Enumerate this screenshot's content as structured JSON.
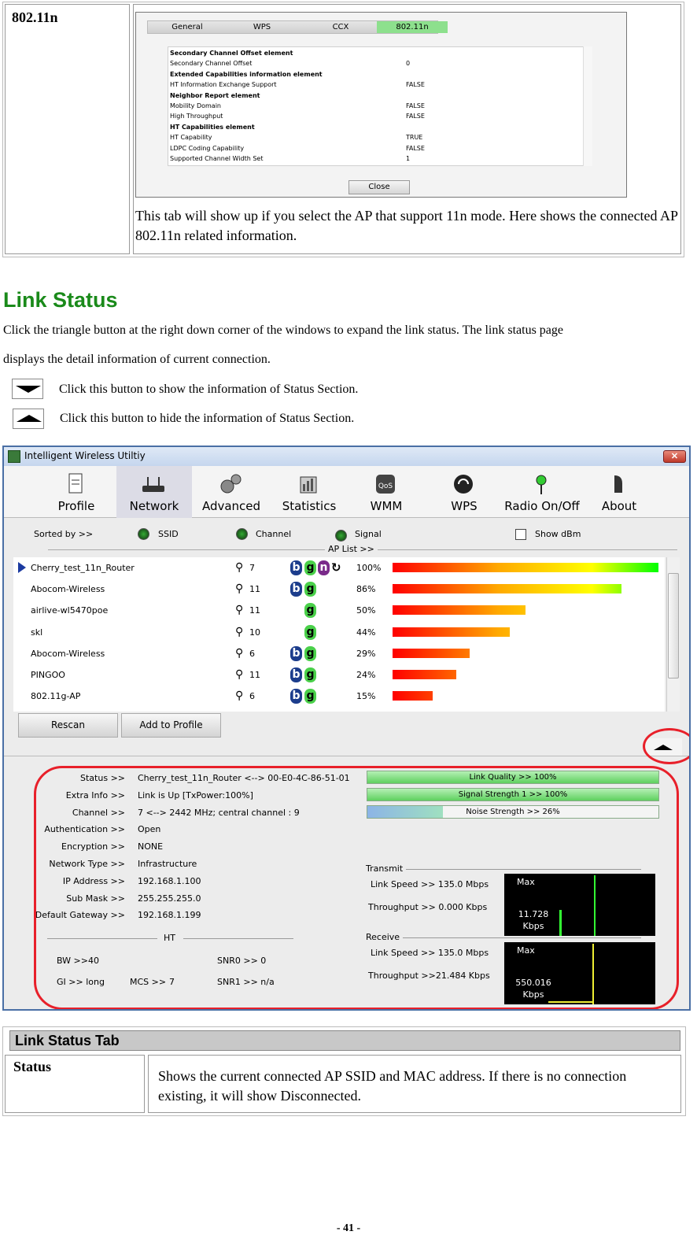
{
  "top_table": {
    "label": "802.11n",
    "screenshot": {
      "tabs": [
        "General",
        "WPS",
        "CCX",
        "802.11n"
      ],
      "active_tab": "802.11n",
      "rows": [
        {
          "name": "Secondary Channel Offset element",
          "value": "",
          "heading": true
        },
        {
          "name": "Secondary Channel Offset",
          "value": "0",
          "heading": false
        },
        {
          "name": "Extended Capabilities information element",
          "value": "",
          "heading": true
        },
        {
          "name": "HT Information Exchange Support",
          "value": "FALSE",
          "heading": false
        },
        {
          "name": "Neighbor Report element",
          "value": "",
          "heading": true
        },
        {
          "name": "Mobility Domain",
          "value": "FALSE",
          "heading": false
        },
        {
          "name": "High Throughput",
          "value": "FALSE",
          "heading": false
        },
        {
          "name": "HT Capabilities element",
          "value": "",
          "heading": true
        },
        {
          "name": "HT Capability",
          "value": "TRUE",
          "heading": false
        },
        {
          "name": "LDPC Coding Capability",
          "value": "FALSE",
          "heading": false
        },
        {
          "name": "Supported Channel Width Set",
          "value": "1",
          "heading": false
        }
      ],
      "close_label": "Close"
    },
    "caption": "This tab will show up if you select the AP that support 11n mode. Here shows the connected AP 802.11n related information."
  },
  "section": {
    "title": "Link Status",
    "intro_line1": "Click the triangle button at the right down corner of the windows to expand the link status. The link status page",
    "intro_line2": "displays the detail information of current connection.",
    "show_text": "Click this button to show the information of Status Section.",
    "hide_text": "Click this button to hide the information of Status Section."
  },
  "app": {
    "title": "Intelligent Wireless Utiltiy",
    "close_glyph": "✕",
    "toolbar": [
      {
        "label": "Profile",
        "icon": "profile-icon"
      },
      {
        "label": "Network",
        "icon": "network-icon"
      },
      {
        "label": "Advanced",
        "icon": "gears-icon"
      },
      {
        "label": "Statistics",
        "icon": "statistics-icon"
      },
      {
        "label": "WMM",
        "icon": "qos-icon"
      },
      {
        "label": "WPS",
        "icon": "wps-icon"
      },
      {
        "label": "Radio On/Off",
        "icon": "radio-icon"
      },
      {
        "label": "About",
        "icon": "about-icon"
      }
    ],
    "active_tool": "Network",
    "sort": {
      "label": "Sorted by >>",
      "ssid": "SSID",
      "channel": "Channel",
      "signal": "Signal",
      "show_dbm": "Show dBm",
      "aplist_title": "AP List >>"
    },
    "ap_list": [
      {
        "ssid": "Cherry_test_11n_Router",
        "channel": "7",
        "modes": [
          "b",
          "g",
          "n"
        ],
        "wps": true,
        "signal": 100,
        "signal_text": "100%",
        "selected": true
      },
      {
        "ssid": "Abocom-Wireless",
        "channel": "11",
        "modes": [
          "b",
          "g"
        ],
        "wps": false,
        "signal": 86,
        "signal_text": "86%",
        "selected": false
      },
      {
        "ssid": "airlive-wl5470poe",
        "channel": "11",
        "modes": [
          "g"
        ],
        "wps": false,
        "signal": 50,
        "signal_text": "50%",
        "selected": false
      },
      {
        "ssid": "skl",
        "channel": "10",
        "modes": [
          "g"
        ],
        "wps": false,
        "signal": 44,
        "signal_text": "44%",
        "selected": false
      },
      {
        "ssid": "Abocom-Wireless",
        "channel": "6",
        "modes": [
          "b",
          "g"
        ],
        "wps": false,
        "signal": 29,
        "signal_text": "29%",
        "selected": false
      },
      {
        "ssid": "PINGOO",
        "channel": "11",
        "modes": [
          "b",
          "g"
        ],
        "wps": false,
        "signal": 24,
        "signal_text": "24%",
        "selected": false
      },
      {
        "ssid": "802.11g-AP",
        "channel": "6",
        "modes": [
          "b",
          "g"
        ],
        "wps": false,
        "signal": 15,
        "signal_text": "15%",
        "selected": false
      }
    ],
    "rescan_label": "Rescan",
    "add_profile_label": "Add to Profile",
    "status": [
      {
        "label": "Status >>",
        "value": "Cherry_test_11n_Router <--> 00-E0-4C-86-51-01"
      },
      {
        "label": "Extra Info >>",
        "value": "Link is Up [TxPower:100%]"
      },
      {
        "label": "Channel >>",
        "value": "7 <--> 2442 MHz; central channel : 9"
      },
      {
        "label": "Authentication >>",
        "value": "Open"
      },
      {
        "label": "Encryption >>",
        "value": "NONE"
      },
      {
        "label": "Network Type >>",
        "value": "Infrastructure"
      },
      {
        "label": "IP Address >>",
        "value": "192.168.1.100"
      },
      {
        "label": "Sub Mask >>",
        "value": "255.255.255.0"
      },
      {
        "label": "Default Gateway >>",
        "value": "192.168.1.199"
      }
    ],
    "meters": [
      {
        "label": "Link Quality >> 100%",
        "level": 1.0,
        "kind": "q"
      },
      {
        "label": "Signal Strength 1 >> 100%",
        "level": 1.0,
        "kind": "q"
      },
      {
        "label": "Noise Strength >> 26%",
        "level": 0.26,
        "kind": "n"
      }
    ],
    "transmit": {
      "title": "Transmit",
      "link_speed": "Link Speed >>  135.0 Mbps",
      "throughput": "Throughput >> 0.000 Kbps",
      "max": "Max",
      "graph_value": "11.728",
      "graph_unit": "Kbps"
    },
    "receive": {
      "title": "Receive",
      "link_speed": "Link Speed >> 135.0 Mbps",
      "throughput": "Throughput >>21.484 Kbps",
      "max": "Max",
      "graph_value": "550.016",
      "graph_unit": "Kbps"
    },
    "ht": {
      "title": "HT",
      "bw": "BW >>40",
      "gi": "GI >> long",
      "mcs_label": "MCS >>",
      "mcs_value": "7",
      "snr0": "SNR0 >>  0",
      "snr1": "SNR1 >>  n/a"
    }
  },
  "bottom_table": {
    "header": "Link Status Tab",
    "label": "Status",
    "description": "Shows the current connected AP SSID and MAC address. If there is no connection existing, it will show Disconnected."
  },
  "page_number": "- 41 -",
  "colors": {
    "accent_green": "#1a8a1a",
    "highlight_red": "#e8202a"
  }
}
